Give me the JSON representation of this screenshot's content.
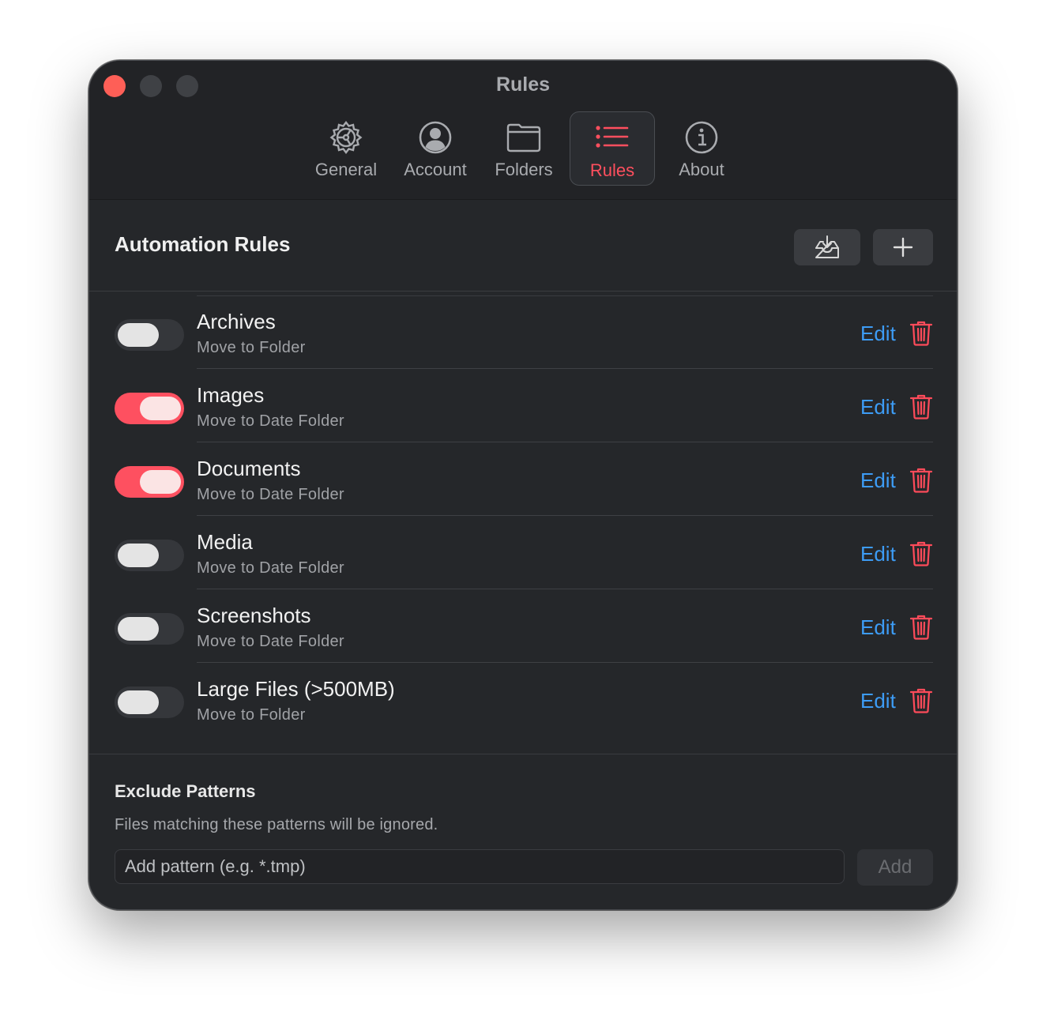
{
  "window": {
    "title": "Rules"
  },
  "tabs": [
    {
      "label": "General",
      "icon": "gear-icon",
      "active": false
    },
    {
      "label": "Account",
      "icon": "person-circle-icon",
      "active": false
    },
    {
      "label": "Folders",
      "icon": "folder-icon",
      "active": false
    },
    {
      "label": "Rules",
      "icon": "list-icon",
      "active": true
    },
    {
      "label": "About",
      "icon": "info-icon",
      "active": false
    }
  ],
  "automation": {
    "title": "Automation Rules",
    "import_icon": "tray-download-icon",
    "add_icon": "plus-icon"
  },
  "rules": [
    {
      "name": "Archives",
      "action": "Move to Folder",
      "enabled": false,
      "edit_label": "Edit"
    },
    {
      "name": "Images",
      "action": "Move to Date Folder",
      "enabled": true,
      "edit_label": "Edit"
    },
    {
      "name": "Documents",
      "action": "Move to Date Folder",
      "enabled": true,
      "edit_label": "Edit"
    },
    {
      "name": "Media",
      "action": "Move to Date Folder",
      "enabled": false,
      "edit_label": "Edit"
    },
    {
      "name": "Screenshots",
      "action": "Move to Date Folder",
      "enabled": false,
      "edit_label": "Edit"
    },
    {
      "name": "Large Files (>500MB)",
      "action": "Move to Folder",
      "enabled": false,
      "edit_label": "Edit"
    }
  ],
  "exclude": {
    "title": "Exclude Patterns",
    "description": "Files matching these patterns will be ignored.",
    "input_placeholder": "Add pattern (e.g. *.tmp)",
    "input_value": "",
    "add_label": "Add"
  },
  "colors": {
    "accent": "#ff4f5e",
    "link": "#3d9cf5",
    "background": "#25272a",
    "toggle_on": "#fe5060"
  }
}
